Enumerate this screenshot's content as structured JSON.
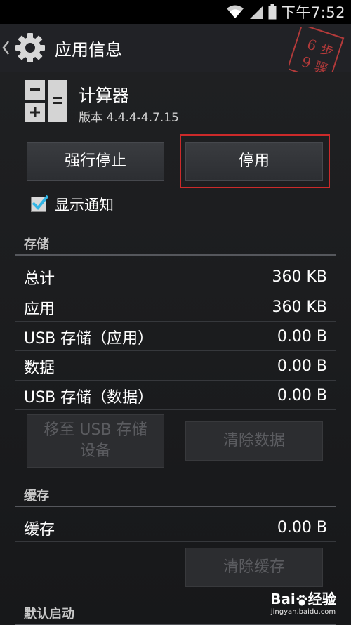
{
  "status": {
    "time": "下午7:52",
    "wifi_icon": "wifi-icon",
    "signal_icon": "signal-icon",
    "battery_icon": "battery-icon"
  },
  "actionbar": {
    "title": "应用信息",
    "up_icon": "chevron-left-icon",
    "settings_icon": "gear-icon"
  },
  "watermark": {
    "text": [
      "6",
      "步",
      "9",
      "骤"
    ],
    "color": "#b23a3a"
  },
  "app": {
    "name": "计算器",
    "version": "版本 4.4.4-4.7.15",
    "icon": "calculator-icon"
  },
  "buttons": {
    "force_stop": "强行停止",
    "disable": "停用"
  },
  "notifications": {
    "label": "显示通知",
    "checked": true,
    "check_color": "#33b5e5"
  },
  "storage": {
    "header": "存储",
    "rows": [
      {
        "label": "总计",
        "value": "360 KB"
      },
      {
        "label": "应用",
        "value": "360 KB"
      },
      {
        "label": "USB 存储（应用）",
        "value": "0.00 B"
      },
      {
        "label": "数据",
        "value": "0.00 B"
      },
      {
        "label": "USB 存储（数据）",
        "value": "0.00 B"
      }
    ],
    "move_button_line1": "移至 USB 存储",
    "move_button_line2": "设备",
    "clear_data_button": "清除数据"
  },
  "cache": {
    "header": "缓存",
    "row": {
      "label": "缓存",
      "value": "0.00 B"
    },
    "clear_cache_button": "清除缓存"
  },
  "default_launch": {
    "header": "默认启动"
  },
  "baidu": {
    "logo_text": "Bai",
    "logo_text2": "经验",
    "site": "jingyan.baidu.com"
  }
}
